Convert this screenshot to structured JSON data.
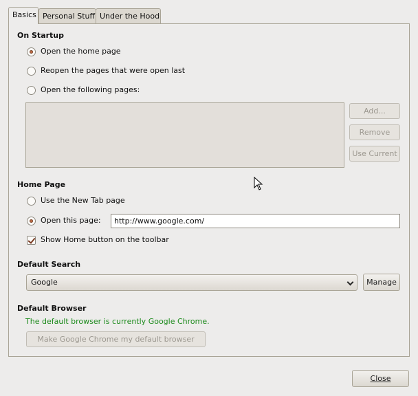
{
  "tabs": [
    {
      "label": "Basics"
    },
    {
      "label": "Personal Stuff"
    },
    {
      "label": "Under the Hood"
    }
  ],
  "startup": {
    "title": "On Startup",
    "options": [
      {
        "label": "Open the home page",
        "checked": true
      },
      {
        "label": "Reopen the pages that were open last",
        "checked": false
      },
      {
        "label": "Open the following pages:",
        "checked": false
      }
    ],
    "buttons": {
      "add": "Add...",
      "remove": "Remove",
      "use_current": "Use Current"
    }
  },
  "home_page": {
    "title": "Home Page",
    "new_tab_label": "Use the New Tab page",
    "open_this_label": "Open this page:",
    "url_value": "http://www.google.com/",
    "show_home_label": "Show Home button on the toolbar",
    "show_home_checked": true
  },
  "default_search": {
    "title": "Default Search",
    "selected": "Google",
    "manage_label": "Manage"
  },
  "default_browser": {
    "title": "Default Browser",
    "status": "The default browser is currently Google Chrome.",
    "make_default_label": "Make Google Chrome my default browser"
  },
  "footer": {
    "close_label": "Close"
  },
  "icons": {
    "cursor": "mouse-pointer-icon",
    "combo_arrow": "chevron-down-icon"
  },
  "colors": {
    "status_green": "#1b8a1b",
    "radio_dot": "#c16a43"
  }
}
